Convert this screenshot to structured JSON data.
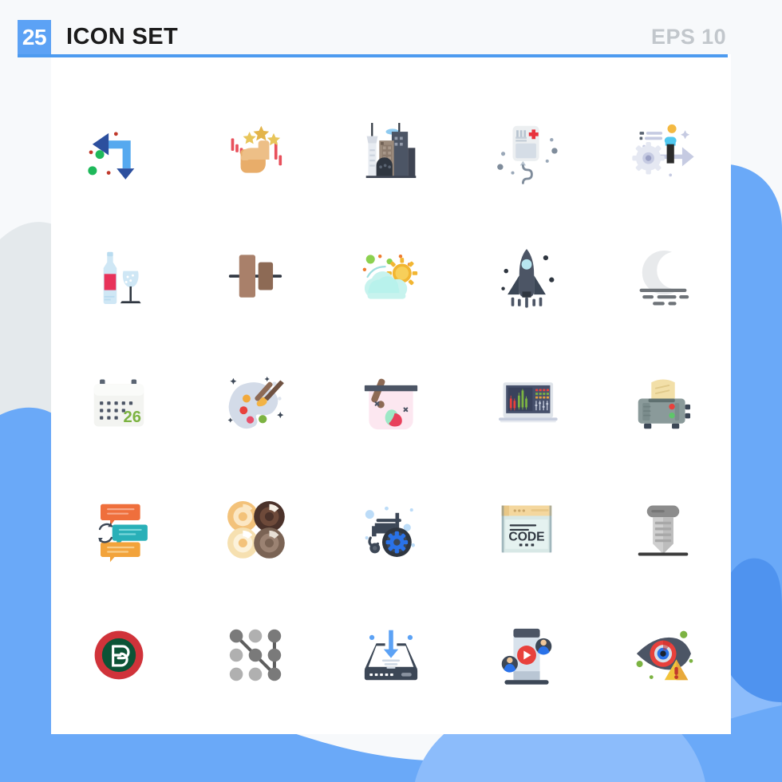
{
  "header": {
    "count": "25",
    "title": "ICON SET",
    "format": "EPS 10",
    "badge_color": "#5ca2f5",
    "rule_color": "#4d9bf0",
    "title_color": "#1b1b1b",
    "format_color": "#c2c7cc"
  },
  "canvas": {
    "background_color": "#f7f9fb",
    "card_color": "#ffffff",
    "blob_blue": "#6aa9f8",
    "blob_blue_light": "#8cbcfb",
    "blob_gray": "#e4e9ec"
  },
  "grid": {
    "columns": 5,
    "rows": 5,
    "total": 25
  },
  "icons": [
    {
      "index": 1,
      "name": "arrows-direction-icon",
      "label": "Arrows Direction",
      "row": 1,
      "col": 1,
      "colors": [
        "#2c4f9e",
        "#56a9ef",
        "#1eb85a",
        "#c0392b"
      ]
    },
    {
      "index": 2,
      "name": "hand-rating-stars-icon",
      "label": "Hand Rating Stars",
      "row": 1,
      "col": 2,
      "colors": [
        "#edbf87",
        "#e8ad6a",
        "#e3b44a",
        "#e8505b"
      ]
    },
    {
      "index": 3,
      "name": "city-buildings-icon",
      "label": "City Buildings",
      "row": 1,
      "col": 3,
      "colors": [
        "#3e4452",
        "#8c7b6d",
        "#d6dbe4",
        "#8ecaf0"
      ]
    },
    {
      "index": 4,
      "name": "iv-blood-bag-icon",
      "label": "IV Blood Bag",
      "row": 1,
      "col": 4,
      "colors": [
        "#eceff1",
        "#d5dde6",
        "#e8323c",
        "#7f8c9b"
      ]
    },
    {
      "index": 5,
      "name": "gear-process-arrow-icon",
      "label": "Gear Process Arrow",
      "row": 1,
      "col": 5,
      "colors": [
        "#c6cbe2",
        "#50c8f0",
        "#2b2b2b",
        "#f4b942"
      ]
    },
    {
      "index": 6,
      "name": "wine-bottle-glass-icon",
      "label": "Wine Bottle And Glass",
      "row": 2,
      "col": 1,
      "colors": [
        "#cfe7f5",
        "#e8325a",
        "#2f3640"
      ]
    },
    {
      "index": 7,
      "name": "align-objects-icon",
      "label": "Align Objects",
      "row": 2,
      "col": 2,
      "colors": [
        "#a9806a",
        "#8d6a55",
        "#2f3640"
      ]
    },
    {
      "index": 8,
      "name": "cloudy-sun-weather-icon",
      "label": "Cloudy Sun Weather",
      "row": 2,
      "col": 3,
      "colors": [
        "#b8f2ec",
        "#f2b632",
        "#8cd14f",
        "#ef7c2f"
      ]
    },
    {
      "index": 9,
      "name": "space-shuttle-icon",
      "label": "Space Shuttle",
      "row": 2,
      "col": 4,
      "colors": [
        "#4c5565",
        "#cfd6e0",
        "#2f3640",
        "#b8e6f0"
      ]
    },
    {
      "index": 10,
      "name": "moon-fog-night-icon",
      "label": "Moon Fog Night",
      "row": 2,
      "col": 5,
      "colors": [
        "#e8eaec",
        "#6e7378"
      ]
    },
    {
      "index": 11,
      "name": "calendar-date-icon",
      "label": "Calendar Date 26",
      "row": 3,
      "col": 1,
      "value": "26",
      "colors": [
        "#f3f4f1",
        "#5a6472",
        "#7cb342"
      ]
    },
    {
      "index": 12,
      "name": "paint-palette-brush-icon",
      "label": "Paint Palette Brush",
      "row": 3,
      "col": 2,
      "colors": [
        "#d3dbe8",
        "#8d6a55",
        "#f2a93b",
        "#e8413c",
        "#7cb342"
      ]
    },
    {
      "index": 13,
      "name": "mixing-bowl-icon",
      "label": "Mixing Bowl",
      "row": 3,
      "col": 3,
      "colors": [
        "#fce7f0",
        "#4c5565",
        "#8d6a55",
        "#9de8c6",
        "#e8415c"
      ]
    },
    {
      "index": 14,
      "name": "trading-chart-screen-icon",
      "label": "Trading Chart Screen",
      "row": 3,
      "col": 4,
      "colors": [
        "#dfe4ea",
        "#46506b",
        "#7cb342",
        "#e8413c"
      ]
    },
    {
      "index": 15,
      "name": "toaster-bread-icon",
      "label": "Toaster Bread",
      "row": 3,
      "col": 5,
      "colors": [
        "#8a9a9a",
        "#f2dfa8",
        "#e8413c",
        "#5ec66a",
        "#3c4756"
      ]
    },
    {
      "index": 16,
      "name": "chat-sync-icon",
      "label": "Chat Sync",
      "row": 4,
      "col": 1,
      "colors": [
        "#ef6f3c",
        "#29b0b8",
        "#f2a33b",
        "#3c4756"
      ]
    },
    {
      "index": 17,
      "name": "donut-rings-icon",
      "label": "Donut Rings",
      "row": 4,
      "col": 2,
      "colors": [
        "#f3c27a",
        "#4b322a",
        "#f6e0b0",
        "#7a6354"
      ]
    },
    {
      "index": 18,
      "name": "wheelchair-settings-icon",
      "label": "Wheelchair Settings",
      "row": 4,
      "col": 3,
      "colors": [
        "#3c4756",
        "#2a72e8",
        "#bcdcf8"
      ]
    },
    {
      "index": 19,
      "name": "code-browser-window-icon",
      "label": "Code Browser Window",
      "row": 4,
      "col": 4,
      "value": "CODE",
      "colors": [
        "#f4d79e",
        "#d8e8e6",
        "#607d8b",
        "#2f3640"
      ]
    },
    {
      "index": 20,
      "name": "screw-bolt-icon",
      "label": "Screw Bolt",
      "row": 4,
      "col": 5,
      "colors": [
        "#8c8c8c",
        "#b5b5b5",
        "#cfcfcf",
        "#3c3c3c"
      ]
    },
    {
      "index": 21,
      "name": "portugal-flag-badge-icon",
      "label": "Portugal Flag Badge",
      "row": 5,
      "col": 1,
      "colors": [
        "#d0333a",
        "#0c5336",
        "#ffffff"
      ]
    },
    {
      "index": 22,
      "name": "pattern-lock-icon",
      "label": "Pattern Lock",
      "row": 5,
      "col": 2,
      "colors": [
        "#7a7a7a",
        "#b0b0b0",
        "#5e5e5e"
      ]
    },
    {
      "index": 23,
      "name": "download-drive-icon",
      "label": "Download Drive",
      "row": 5,
      "col": 3,
      "colors": [
        "#3c4756",
        "#5ca2f5",
        "#ffffff"
      ]
    },
    {
      "index": 24,
      "name": "video-streaming-users-icon",
      "label": "Video Streaming Users",
      "row": 5,
      "col": 4,
      "colors": [
        "#3c4756",
        "#d8e2ec",
        "#e8413c",
        "#2a72e8"
      ]
    },
    {
      "index": 25,
      "name": "eye-warning-icon",
      "label": "Eye Warning",
      "row": 5,
      "col": 5,
      "colors": [
        "#4c5565",
        "#e8413c",
        "#2a72e8",
        "#f2c33b",
        "#7cb342"
      ]
    }
  ]
}
